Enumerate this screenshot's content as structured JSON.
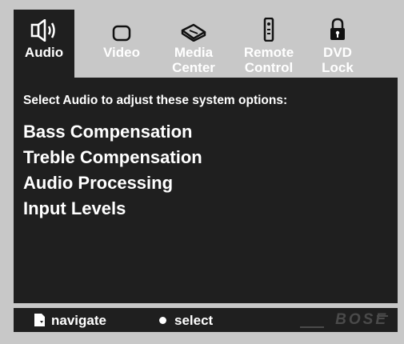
{
  "tabs": [
    {
      "label_line1": "Audio",
      "label_line2": "",
      "icon": "speaker-icon",
      "active": true
    },
    {
      "label_line1": "Video",
      "label_line2": "",
      "icon": "tv-icon",
      "active": false
    },
    {
      "label_line1": "Media",
      "label_line2": "Center",
      "icon": "media-center-icon",
      "active": false
    },
    {
      "label_line1": "Remote",
      "label_line2": "Control",
      "icon": "remote-control-icon",
      "active": false
    },
    {
      "label_line1": "DVD",
      "label_line2": "Lock",
      "icon": "lock-icon",
      "active": false
    }
  ],
  "main": {
    "prompt": "Select Audio to adjust these system options:",
    "options": [
      "Bass Compensation",
      "Treble Compensation",
      "Audio Processing",
      "Input Levels"
    ]
  },
  "footer": {
    "navigate_label": "navigate",
    "select_label": "select",
    "brand": "BOSE"
  },
  "colors": {
    "panel": "#1f1f1f",
    "frame": "#c8c8c8",
    "text": "#ffffff",
    "brand": "#4a4a4a"
  }
}
